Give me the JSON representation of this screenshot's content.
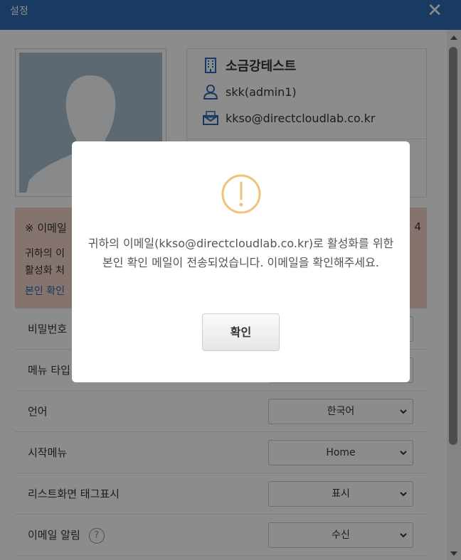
{
  "window": {
    "title": "설정",
    "close_glyph": "✕"
  },
  "profile": {
    "org_name": "소금강테스트",
    "user": "skk(admin1)",
    "email": "kkso@directcloudlab.co.kr",
    "icons": [
      "building-icon",
      "user-icon",
      "mail-icon"
    ]
  },
  "notice": {
    "title": "이메일",
    "line1": "귀하의 이",
    "line2": "활성화 처",
    "link": "본인 확인",
    "right_text": "4",
    "icon": "asterisk-icon"
  },
  "settings": {
    "password_label": "비밀번호",
    "menu_type_label": "메뉴 타입",
    "language": {
      "label": "언어",
      "value": "한국어"
    },
    "start_menu": {
      "label": "시작메뉴",
      "value": "Home"
    },
    "tag_display": {
      "label": "리스트화면 태그표시",
      "value": "표시"
    },
    "email_alert": {
      "label": "이메일 알림",
      "value": "수신",
      "help": "?"
    }
  },
  "dialog": {
    "message": "귀하의 이메일(kkso@directcloudlab.co.kr)로 활성화를 위한 본인 확인 메일이 전송되었습니다. 이메일을 확인해주세요.",
    "ok_label": "확인",
    "icon": "warning-circle-icon"
  },
  "colors": {
    "titlebar": "#2e6bb5",
    "notice_bg": "#f2d2c8",
    "warning": "#f0c27b",
    "link": "#2e6bb5"
  }
}
